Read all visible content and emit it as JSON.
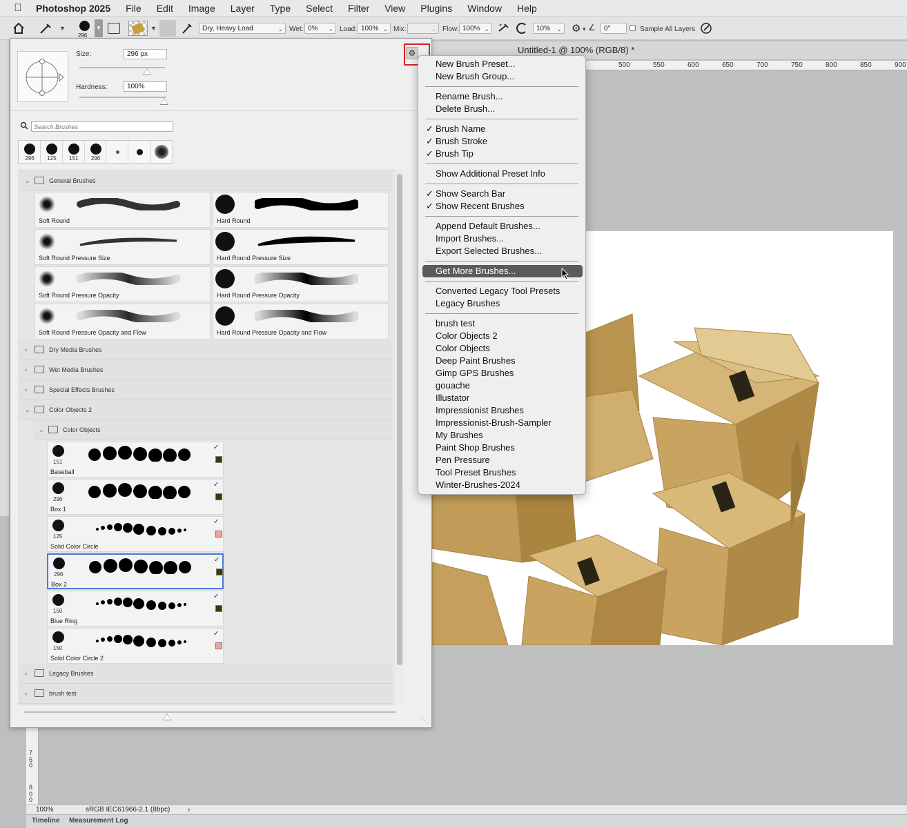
{
  "menubar": {
    "app_name": "Photoshop 2025",
    "items": [
      "File",
      "Edit",
      "Image",
      "Layer",
      "Type",
      "Select",
      "Filter",
      "View",
      "Plugins",
      "Window",
      "Help"
    ]
  },
  "options": {
    "brush_size": "296",
    "mix_preset": "Dry, Heavy Load",
    "wet_label": "Wet:",
    "wet_value": "0%",
    "load_label": "Load:",
    "load_value": "100%",
    "mix_label": "Mix:",
    "mix_value": "",
    "flow_label": "Flow:",
    "flow_value": "100%",
    "smoothing_value": "10%",
    "angle_value": "0°",
    "sample_all_layers": "Sample All Layers"
  },
  "panel": {
    "size_label": "Size:",
    "size_value": "296 px",
    "hardness_label": "Hardness:",
    "hardness_value": "100%",
    "search_placeholder": "Search Brushes",
    "recent": [
      "296",
      "125",
      "151",
      "296",
      "",
      "",
      ""
    ],
    "general_group": "General Brushes",
    "general_brushes": [
      {
        "name": "Soft Round",
        "hard": false
      },
      {
        "name": "Hard Round",
        "hard": true
      },
      {
        "name": "Soft Round Pressure Size",
        "hard": false
      },
      {
        "name": "Hard Round Pressure Size",
        "hard": true
      },
      {
        "name": "Soft Round Pressure Opacity",
        "hard": false
      },
      {
        "name": "Hard Round Pressure Opacity",
        "hard": true
      },
      {
        "name": "Soft Round Pressure Opacity and Flow",
        "hard": false
      },
      {
        "name": "Hard Round Pressure Opacity and Flow",
        "hard": true
      }
    ],
    "collapsed_groups": [
      "Dry Media Brushes",
      "Wet Media Brushes",
      "Special Effects Brushes"
    ],
    "color_objects_2": "Color Objects 2",
    "color_objects": "Color Objects",
    "tool_presets": [
      {
        "size": "151",
        "name": "Baseball",
        "swatch": "#3a3a08",
        "style": "big",
        "selected": false
      },
      {
        "size": "296",
        "name": "Box 1",
        "swatch": "#3a3a08",
        "style": "big",
        "selected": false
      },
      {
        "size": "125",
        "name": "Solid Color Circle",
        "swatch": "#f2a0a0",
        "style": "taper",
        "selected": false
      },
      {
        "size": "296",
        "name": "Box 2",
        "swatch": "#3a3a08",
        "style": "big",
        "selected": true
      },
      {
        "size": "150",
        "name": "Blue Ring",
        "swatch": "#3a3a08",
        "style": "taper",
        "selected": false
      },
      {
        "size": "150",
        "name": "Solid Color Circle 2",
        "swatch": "#f2a0a0",
        "style": "taper",
        "selected": false
      }
    ],
    "bottom_groups": [
      "Legacy Brushes",
      "brush test"
    ]
  },
  "menu": {
    "items": [
      {
        "label": "New Brush Preset...",
        "checked": false
      },
      {
        "label": "New Brush Group...",
        "checked": false
      },
      {
        "sep": true
      },
      {
        "label": "Rename Brush...",
        "checked": false
      },
      {
        "label": "Delete Brush...",
        "checked": false
      },
      {
        "sep": true
      },
      {
        "label": "Brush Name",
        "checked": true
      },
      {
        "label": "Brush Stroke",
        "checked": true
      },
      {
        "label": "Brush Tip",
        "checked": true
      },
      {
        "sep": true
      },
      {
        "label": "Show Additional Preset Info",
        "checked": false
      },
      {
        "sep": true
      },
      {
        "label": "Show Search Bar",
        "checked": true
      },
      {
        "label": "Show Recent Brushes",
        "checked": true
      },
      {
        "sep": true
      },
      {
        "label": "Append Default Brushes...",
        "checked": false
      },
      {
        "label": "Import Brushes...",
        "checked": false
      },
      {
        "label": "Export Selected Brushes...",
        "checked": false
      },
      {
        "sep": true
      },
      {
        "label": "Get More Brushes...",
        "checked": false,
        "highlight": true
      },
      {
        "sep": true
      },
      {
        "label": "Converted Legacy Tool Presets",
        "checked": false
      },
      {
        "label": "Legacy Brushes",
        "checked": false
      },
      {
        "sep": true
      },
      {
        "label": "brush test",
        "checked": false
      },
      {
        "label": "Color Objects 2",
        "checked": false
      },
      {
        "label": "Color Objects",
        "checked": false
      },
      {
        "label": "Deep Paint Brushes",
        "checked": false
      },
      {
        "label": "Gimp GPS Brushes",
        "checked": false
      },
      {
        "label": "gouache",
        "checked": false
      },
      {
        "label": "Illustator",
        "checked": false
      },
      {
        "label": "Impressionist Brushes",
        "checked": false
      },
      {
        "label": "Impressionist-Brush-Sampler",
        "checked": false
      },
      {
        "label": "My Brushes",
        "checked": false
      },
      {
        "label": "Paint Shop Brushes",
        "checked": false
      },
      {
        "label": "Pen Pressure",
        "checked": false
      },
      {
        "label": "Tool Preset Brushes",
        "checked": false
      },
      {
        "label": "Winter-Brushes-2024",
        "checked": false
      }
    ]
  },
  "document": {
    "title": "Untitled-1 @ 100% (RGB/8) *",
    "ruler_ticks": [
      "500",
      "550",
      "600",
      "650",
      "700",
      "750",
      "800",
      "850",
      "900"
    ],
    "left_ruler": [
      "7",
      "5",
      "0",
      "8",
      "0",
      "0"
    ]
  },
  "status": {
    "zoom": "100%",
    "profile": "sRGB IEC61966-2.1 (8bpc)"
  },
  "bottom_tabs": [
    "Timeline",
    "Measurement Log"
  ]
}
